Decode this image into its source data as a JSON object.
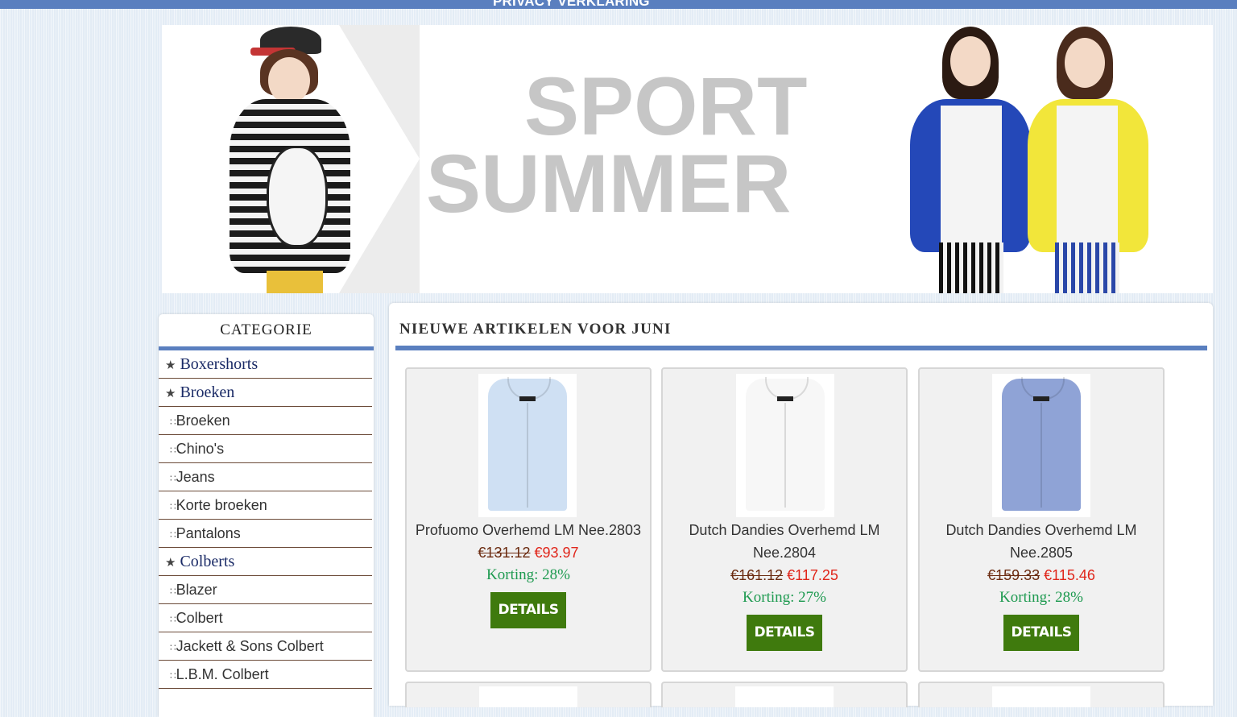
{
  "topbar": {
    "link": "PRIVACY VERKLARING"
  },
  "banner": {
    "line1": "SPORT",
    "line2": "SUMMER"
  },
  "sidebar": {
    "title": "CATEGORIE",
    "items": [
      {
        "label": "Boxershorts",
        "level": "top"
      },
      {
        "label": "Broeken",
        "level": "top"
      },
      {
        "label": "Broeken",
        "level": "sub"
      },
      {
        "label": "Chino's",
        "level": "sub"
      },
      {
        "label": "Jeans",
        "level": "sub"
      },
      {
        "label": "Korte broeken",
        "level": "sub"
      },
      {
        "label": "Pantalons",
        "level": "sub"
      },
      {
        "label": "Colberts",
        "level": "top"
      },
      {
        "label": "Blazer",
        "level": "sub"
      },
      {
        "label": "Colbert",
        "level": "sub"
      },
      {
        "label": "Jackett & Sons Colbert",
        "level": "sub"
      },
      {
        "label": "L.B.M. Colbert",
        "level": "sub"
      }
    ]
  },
  "main": {
    "title": "NIEUWE ARTIKELEN VOOR JUNI",
    "products": [
      {
        "name": "Profuomo Overhemd LM Nee.2803",
        "old_price": "€131.12",
        "price": "€93.97",
        "discount": "Korting: 28%",
        "button": "DETAILS",
        "shirt_color": "#cfe0f3"
      },
      {
        "name": "Dutch Dandies Overhemd LM Nee.2804",
        "old_price": "€161.12",
        "price": "€117.25",
        "discount": "Korting: 27%",
        "button": "DETAILS",
        "shirt_color": "#f7f7f7"
      },
      {
        "name": "Dutch Dandies Overhemd LM Nee.2805",
        "old_price": "€159.33",
        "price": "€115.46",
        "discount": "Korting: 28%",
        "button": "DETAILS",
        "shirt_color": "#8fa3d6"
      }
    ]
  },
  "colors": {
    "accent": "#5a7fbf",
    "button": "#3f7a0d",
    "price": "#e0261b",
    "discount": "#1e9a50"
  }
}
